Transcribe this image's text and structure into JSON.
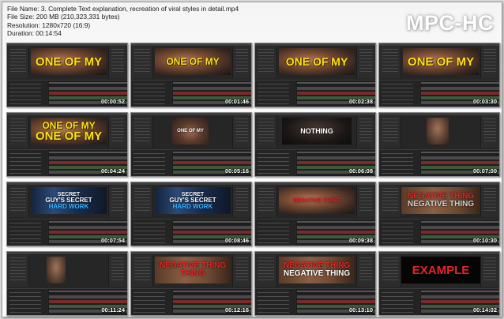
{
  "header": {
    "file_name": "File Name: 3. Complete Text explanation, recreation of viral styles in detail.mp4",
    "file_size": "File Size: 200 MB (210,323,331 bytes)",
    "resolution": "Resolution: 1280x720 (16:9)",
    "duration": "Duration: 00:14:54"
  },
  "brand": "MPC-HC",
  "thumbnails": [
    {
      "time": "00:00:52",
      "caption": [
        "ONE OF MY"
      ]
    },
    {
      "time": "00:01:46",
      "caption": [
        "ONE OF MY"
      ]
    },
    {
      "time": "00:02:38",
      "caption": [
        "ONE OF MY"
      ]
    },
    {
      "time": "00:03:30",
      "caption": [
        "ONE OF MY"
      ]
    },
    {
      "time": "00:04:24",
      "caption": [
        "ONE OF MY",
        "ONE OF MY"
      ]
    },
    {
      "time": "00:05:16",
      "caption": [
        "ONE OF MY"
      ]
    },
    {
      "time": "00:06:08",
      "caption": [
        "NOTHING"
      ]
    },
    {
      "time": "00:07:00",
      "caption": []
    },
    {
      "time": "00:07:54",
      "caption": [
        "SECRET",
        "GUY'S SECRET",
        "HARD WORK"
      ]
    },
    {
      "time": "00:08:46",
      "caption": [
        "SECRET",
        "GUY'S SECRET",
        "HARD WORK"
      ]
    },
    {
      "time": "00:09:38",
      "caption": [
        "NEGATIVE THING"
      ]
    },
    {
      "time": "00:10:30",
      "caption": [
        "NEGATIVE THING",
        "NEGATIVE THING"
      ]
    },
    {
      "time": "00:11:24",
      "caption": []
    },
    {
      "time": "00:12:16",
      "caption": [
        "NEGATIVE THING",
        "THING"
      ]
    },
    {
      "time": "00:13:10",
      "caption": [
        "NEGATIVE THING",
        "NEGATIVE THING"
      ]
    },
    {
      "time": "00:14:02",
      "caption": [
        "EXAMPLE"
      ]
    }
  ]
}
